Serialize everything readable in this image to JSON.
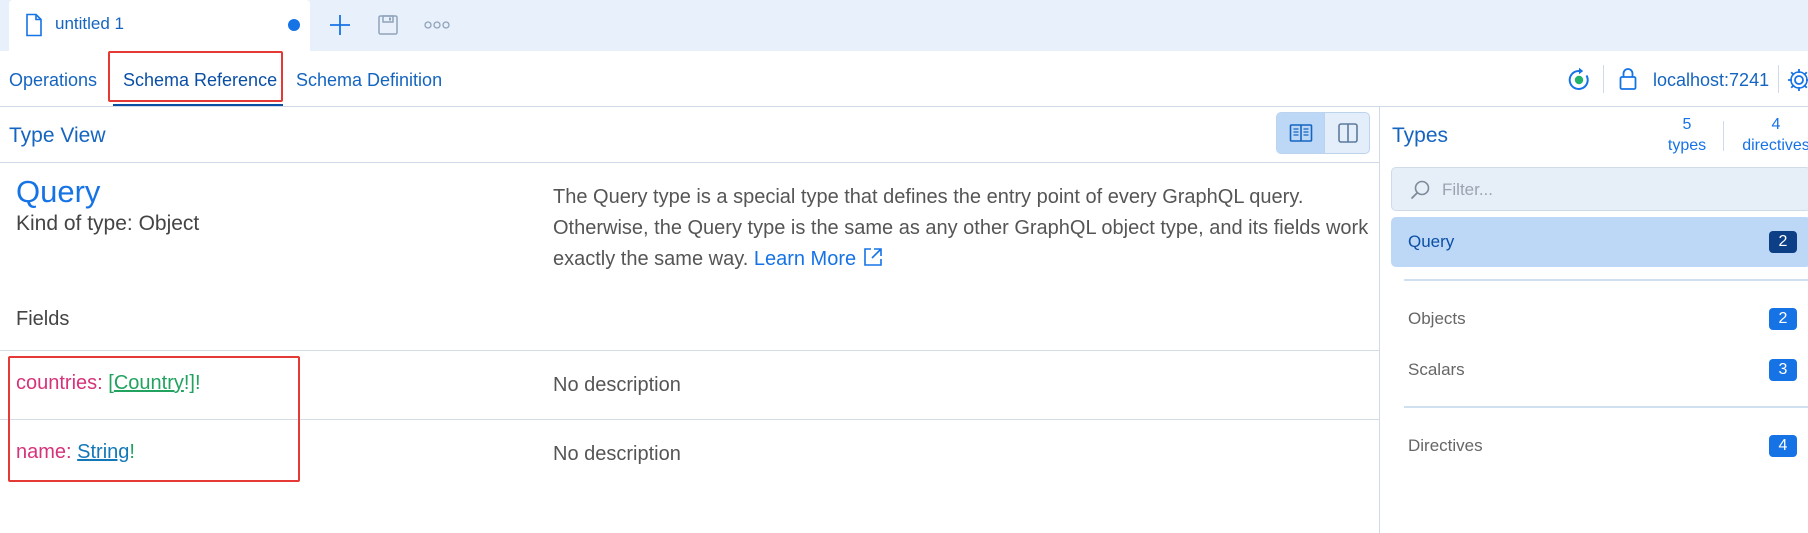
{
  "document_tab": {
    "title": "untitled 1"
  },
  "nav": {
    "tabs": [
      {
        "label": "Operations"
      },
      {
        "label": "Schema Reference"
      },
      {
        "label": "Schema Definition"
      }
    ],
    "endpoint": "localhost:7241"
  },
  "type_view": {
    "header": "Type View",
    "type_name": "Query",
    "kind": "Kind of type: Object",
    "description": "The Query type is a special type that defines the entry point of every GraphQL query. Otherwise, the Query type is the same as any other GraphQL object type, and its fields work exactly the same way.",
    "learn_more": "Learn More",
    "fields_label": "Fields",
    "fields": [
      {
        "name": "countries",
        "colon": ":",
        "open": "[",
        "type": "Country",
        "close": "!]!",
        "description": "No description"
      },
      {
        "name": "name",
        "colon": ":",
        "type": "String",
        "suffix": "!",
        "description": "No description"
      }
    ]
  },
  "sidebar": {
    "title": "Types",
    "types_count": "5",
    "types_label": "types",
    "directives_count": "4",
    "directives_label": "directives",
    "filter_placeholder": "Filter...",
    "items": [
      {
        "label": "Query",
        "count": "2"
      },
      {
        "label": "Objects",
        "count": "2"
      },
      {
        "label": "Scalars",
        "count": "3"
      },
      {
        "label": "Directives",
        "count": "4"
      }
    ]
  },
  "colors": {
    "accent": "#1673e6",
    "field_name": "#d6337a",
    "object_type": "#21a35f",
    "scalar_type": "#1478b8",
    "annotation": "#e53935"
  }
}
